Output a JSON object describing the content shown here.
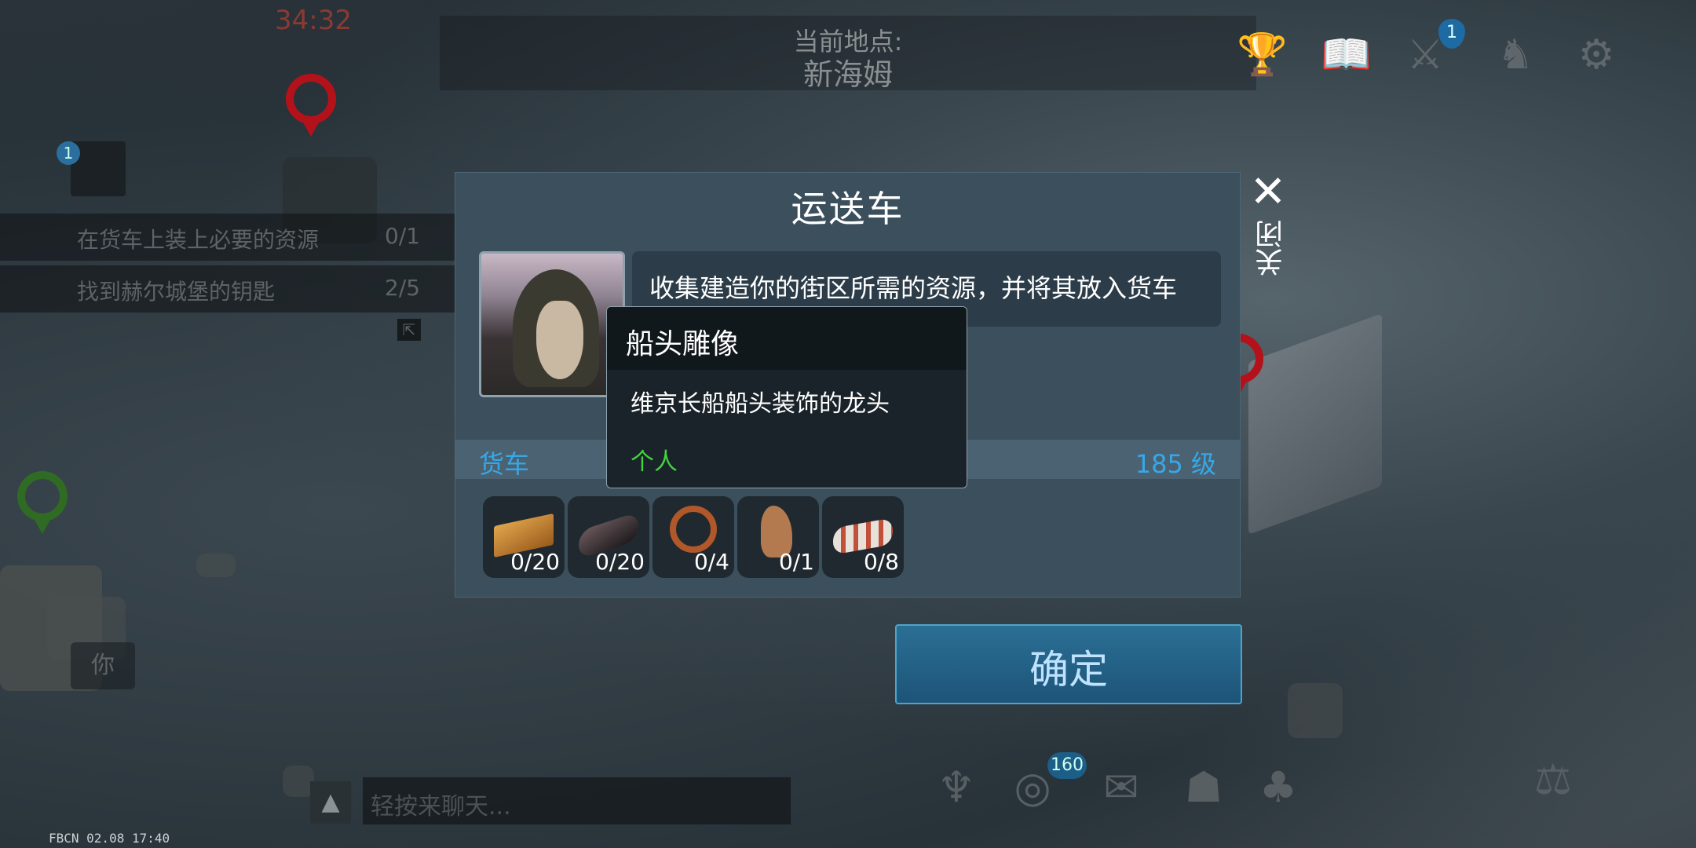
{
  "hud": {
    "timer": "34:32",
    "location_label": "当前地点:",
    "location_name": "新海姆",
    "shield_badge": "1"
  },
  "quests": {
    "badge": "1",
    "items": [
      {
        "text": "在货车上装上必要的资源",
        "count": "0/1"
      },
      {
        "text": "找到赫尔城堡的钥匙",
        "count": "2/5"
      }
    ]
  },
  "map": {
    "you_label": "你"
  },
  "dialog": {
    "title": "运送车",
    "close_label": "关闭",
    "speech": "收集建造你的街区所需的资源，并将其放入货车",
    "bar_left": "货车",
    "bar_right": "185 级",
    "slots": [
      {
        "icon": "wood-plank-icon",
        "qty": "0/20"
      },
      {
        "icon": "iron-bar-icon",
        "qty": "0/20"
      },
      {
        "icon": "ship-wheel-icon",
        "qty": "0/4"
      },
      {
        "icon": "dragon-figurehead-icon",
        "qty": "0/1"
      },
      {
        "icon": "cloth-roll-icon",
        "qty": "0/8"
      }
    ],
    "confirm_label": "确定"
  },
  "tooltip": {
    "title": "船头雕像",
    "description": "维京长船船头装饰的龙头",
    "tag": "个人"
  },
  "bottom": {
    "chat_placeholder": "轻按来聊天...",
    "coin_badge": "160",
    "build_info": "FBCN 02.08 17:40"
  },
  "colors": {
    "accent_blue": "#37a7e6",
    "tag_green": "#43d33f",
    "pin_red": "#b3121a",
    "pin_green": "#2f6b22"
  }
}
